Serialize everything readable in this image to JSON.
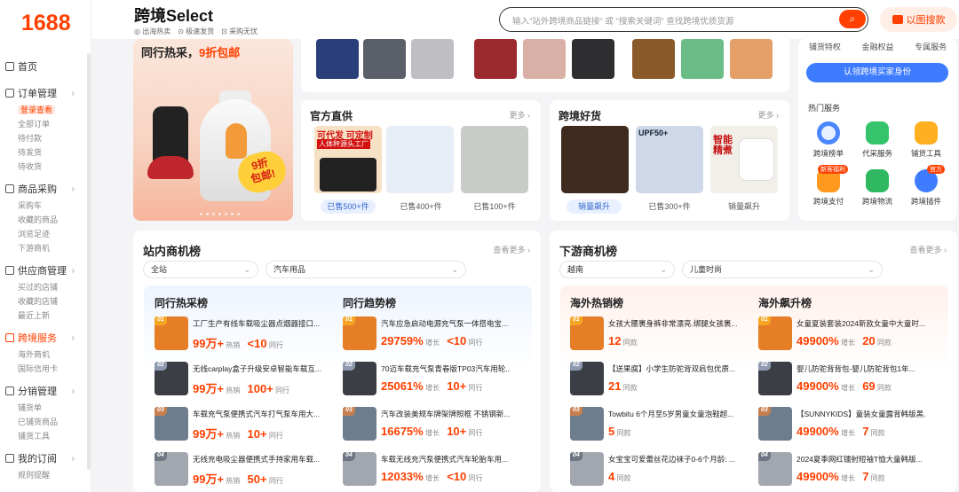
{
  "logo": "1688",
  "sidebar": {
    "home": "首页",
    "groups": [
      {
        "title": "订单管理",
        "items": [
          "登录查看",
          "全部订单",
          "待付款",
          "待发货",
          "待收货"
        ]
      },
      {
        "title": "商品采购",
        "items": [
          "采购车",
          "收藏的商品",
          "浏览足迹",
          "下游商机"
        ]
      },
      {
        "title": "供应商管理",
        "items": [
          "买过的店铺",
          "收藏的店铺",
          "最近上新"
        ]
      },
      {
        "title": "跨境服务",
        "items": [
          "海外商机",
          "国际信用卡"
        ]
      },
      {
        "title": "分销管理",
        "items": [
          "铺货单",
          "已铺货商品",
          "铺货工具"
        ]
      },
      {
        "title": "我的订阅",
        "items": [
          "规则提醒"
        ]
      }
    ]
  },
  "header": {
    "brand": "跨境Select",
    "subs": [
      "出海热卖",
      "极速发货",
      "采购无忧"
    ],
    "search_placeholder": "输入\"站外跨境商品链接\" 或 \"搜索关键词\" 查找跨境优质货源",
    "image_search": "以图搜款"
  },
  "banner": {
    "title_pre": "同行热采，",
    "title_hl": "9折包邮",
    "badge_a": "9折",
    "badge_b": "包邮!"
  },
  "official": {
    "title": "官方直供",
    "more": "更多",
    "tags": [
      "已售500+件",
      "已售400+件",
      "已售100+件"
    ],
    "prod_text": [
      "可代发",
      "可定制",
      "人体秤源头工厂"
    ]
  },
  "cross": {
    "title": "跨境好货",
    "more": "更多",
    "tags": [
      "销量飙升",
      "已售300+件",
      "销量飙升"
    ],
    "prod_text": [
      "UPF50+",
      "智能精煮"
    ]
  },
  "right_card": {
    "tabs": [
      "铺货特权",
      "金融权益",
      "专属服务"
    ],
    "button": "认领跨境买家身份",
    "hot": "热门服务",
    "services": [
      "跨境榜单",
      "代采服务",
      "铺货工具",
      "跨境支付",
      "跨境物流",
      "跨境插件"
    ],
    "badges": [
      "新客福利",
      "官方"
    ]
  },
  "station": {
    "title": "站内商机榜",
    "more": "查看更多",
    "select1": "全站",
    "select2": "汽车用品",
    "col1": {
      "title": "同行热采榜",
      "rows": [
        {
          "rank": "01",
          "name": "工厂生产有线车载吸尘器点烟器接口...",
          "v1": "99万+",
          "l1": "热销",
          "v2": "<10",
          "l2": "同行"
        },
        {
          "rank": "02",
          "name": "无线carplay盒子升级安卓智能车载互...",
          "v1": "99万+",
          "l1": "热销",
          "v2": "100+",
          "l2": "同行"
        },
        {
          "rank": "03",
          "name": "车载充气泵便携式汽车打气泵车用大...",
          "v1": "99万+",
          "l1": "热销",
          "v2": "10+",
          "l2": "同行"
        },
        {
          "rank": "04",
          "name": "无线充电吸尘器便携式手持家用车载...",
          "v1": "99万+",
          "l1": "热销",
          "v2": "50+",
          "l2": "同行"
        }
      ]
    },
    "col2": {
      "title": "同行趋势榜",
      "rows": [
        {
          "rank": "01",
          "name": "汽车应急启动电源充气泵一体搭电宝...",
          "v1": "29759%",
          "l1": "增长",
          "v2": "<10",
          "l2": "同行"
        },
        {
          "rank": "02",
          "name": "70迈车载充气泵青春版TP03汽车用轮...",
          "v1": "25061%",
          "l1": "增长",
          "v2": "10+",
          "l2": "同行"
        },
        {
          "rank": "03",
          "name": "汽车改装美规车牌架牌照框 不锈钢新...",
          "v1": "16675%",
          "l1": "增长",
          "v2": "10+",
          "l2": "同行"
        },
        {
          "rank": "04",
          "name": "车载无线充汽泵便携式汽车轮胎车用...",
          "v1": "12033%",
          "l1": "增长",
          "v2": "<10",
          "l2": "同行"
        }
      ]
    }
  },
  "downstream": {
    "title": "下游商机榜",
    "more": "查看更多",
    "select1": "越南",
    "select2": "儿童时尚",
    "col1": {
      "title": "海外热销榜",
      "rows": [
        {
          "rank": "01",
          "name": "女孩大腰裹身裤非常漂亮.绑腿女孩裹...",
          "v1": "12",
          "l1": "同款"
        },
        {
          "rank": "02",
          "name": "【送果腐】小学生防驼背双肩包优质...",
          "v1": "21",
          "l1": "同款"
        },
        {
          "rank": "03",
          "name": "Towbitu 6个月至5岁男童女童泡鞋超...",
          "v1": "5",
          "l1": "同款"
        },
        {
          "rank": "04",
          "name": "女宝宝可爱蕾丝花边袜子0-6个月龄: ...",
          "v1": "4",
          "l1": "同款"
        }
      ]
    },
    "col2": {
      "title": "海外飙升榜",
      "rows": [
        {
          "rank": "01",
          "name": "女童夏装套装2024新款女童中大童时...",
          "v1": "49900%",
          "l1": "增长",
          "v2": "20",
          "l2": "同款"
        },
        {
          "rank": "02",
          "name": "婴儿防驼背背包-婴儿防驼背包1年...",
          "v1": "49900%",
          "l1": "增长",
          "v2": "69",
          "l2": "同款"
        },
        {
          "rank": "03",
          "name": "【SUNNYKIDS】童装女童露背韩版黑...",
          "v1": "49900%",
          "l1": "增长",
          "v2": "7",
          "l2": "同款"
        },
        {
          "rank": "04",
          "name": "2024夏季网红镭射短袖T恤大童韩版...",
          "v1": "49900%",
          "l1": "增长",
          "v2": "7",
          "l2": "同款"
        }
      ]
    }
  },
  "colors": {
    "accent": "#ff4000",
    "blue": "#3d7bff"
  }
}
